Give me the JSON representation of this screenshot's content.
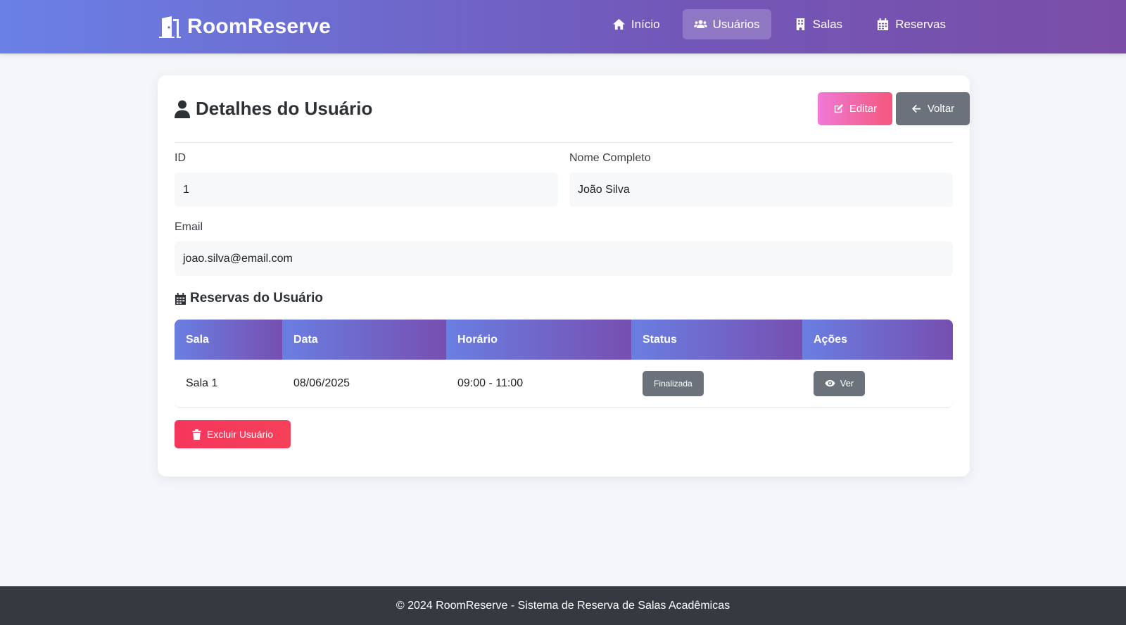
{
  "app": {
    "brand": "RoomReserve"
  },
  "nav": {
    "items": [
      {
        "label": "Início",
        "icon": "home-icon"
      },
      {
        "label": "Usuários",
        "icon": "users-icon",
        "active": true
      },
      {
        "label": "Salas",
        "icon": "building-icon"
      },
      {
        "label": "Reservas",
        "icon": "calendar-icon"
      }
    ]
  },
  "page": {
    "title": "Detalhes do Usuário",
    "edit_label": "Editar",
    "back_label": "Voltar"
  },
  "user": {
    "id_label": "ID",
    "id_value": "1",
    "name_label": "Nome Completo",
    "name_value": "João Silva",
    "email_label": "Email",
    "email_value": "joao.silva@email.com"
  },
  "reservations": {
    "title": "Reservas do Usuário",
    "columns": [
      "Sala",
      "Data",
      "Horário",
      "Status",
      "Ações"
    ],
    "rows": [
      {
        "room": "Sala 1",
        "date": "08/06/2025",
        "time": "09:00 - 11:00",
        "status": "Finalizada",
        "action": "Ver"
      }
    ]
  },
  "delete_label": "Excluir Usuário",
  "footer": {
    "text": "© 2024 RoomReserve - Sistema de Reserva de Salas Acadêmicas"
  },
  "colors": {
    "nav_gradient_start": "#6a80e6",
    "nav_gradient_end": "#7a4ea8",
    "edit_button": "#f5567d",
    "back_button": "#6b727b",
    "delete_button": "#f5365c",
    "footer_bg": "#343a40"
  }
}
